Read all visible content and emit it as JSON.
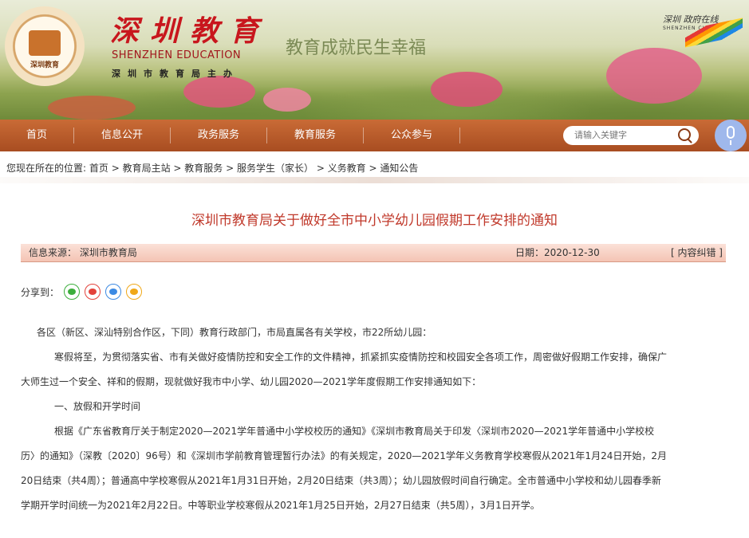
{
  "header": {
    "title_cn": "深圳教育",
    "title_en": "SHENZHEN EDUCATION",
    "sub": "深圳市教育局主办",
    "slogan": "教育成就民生幸福",
    "emblem_text": "深圳教育",
    "right_logo_cn": "深圳 政府在线",
    "right_logo_en": "SHENZHEN CHINA"
  },
  "nav": {
    "items": [
      "首页",
      "信息公开",
      "政务服务",
      "教育服务",
      "公众参与"
    ]
  },
  "search": {
    "placeholder": "请输入关键字"
  },
  "breadcrumb": {
    "prefix": "您现在所在的位置:",
    "items": [
      "首页",
      "教育局主站",
      "教育服务",
      "服务学生（家长）",
      "义务教育",
      "通知公告"
    ]
  },
  "article": {
    "title": "深圳市教育局关于做好全市中小学幼儿园假期工作安排的通知",
    "source": "信息来源：  深圳市教育局",
    "date": "日期：2020-12-30",
    "error_link": "[ 内容纠错 ]",
    "share_label": "分享到：",
    "share_icons": [
      "wechat-icon",
      "weibo-icon",
      "qq-icon",
      "favorite-icon"
    ],
    "p1": "各区（新区、深汕特别合作区，下同）教育行政部门，市局直属各有关学校，市22所幼儿园：",
    "p2a": "寒假将至，为贯彻落实省、市有关做好疫情防控和安全工作的文件精神，抓紧抓实疫情防控和校园安全各项工作，周密做好假期工作安排，确保广",
    "p2b": "大师生过一个安全、祥和的假期，现就做好我市中小学、幼儿园2020—2021学年度假期工作安排通知如下：",
    "p3": "一、放假和开学时间",
    "p4a": "根据《广东省教育厅关于制定2020—2021学年普通中小学校校历的通知》《深圳市教育局关于印发〈深圳市2020—2021学年普通中小学校校",
    "p4b": "历〉的通知》（深教〔2020〕96号）和《深圳市学前教育管理暂行办法》的有关规定，2020—2021学年义务教育学校寒假从2021年1月24日开始，2月",
    "p4c": "20日结束（共4周）；普通高中学校寒假从2021年1月31日开始，2月20日结束（共3周）；幼儿园放假时间自行确定。全市普通中小学校和幼儿园春季新",
    "p4d": "学期开学时间统一为2021年2月22日。中等职业学校寒假从2021年1月25日开始，2月27日结束（共5周），3月1日开学。"
  }
}
